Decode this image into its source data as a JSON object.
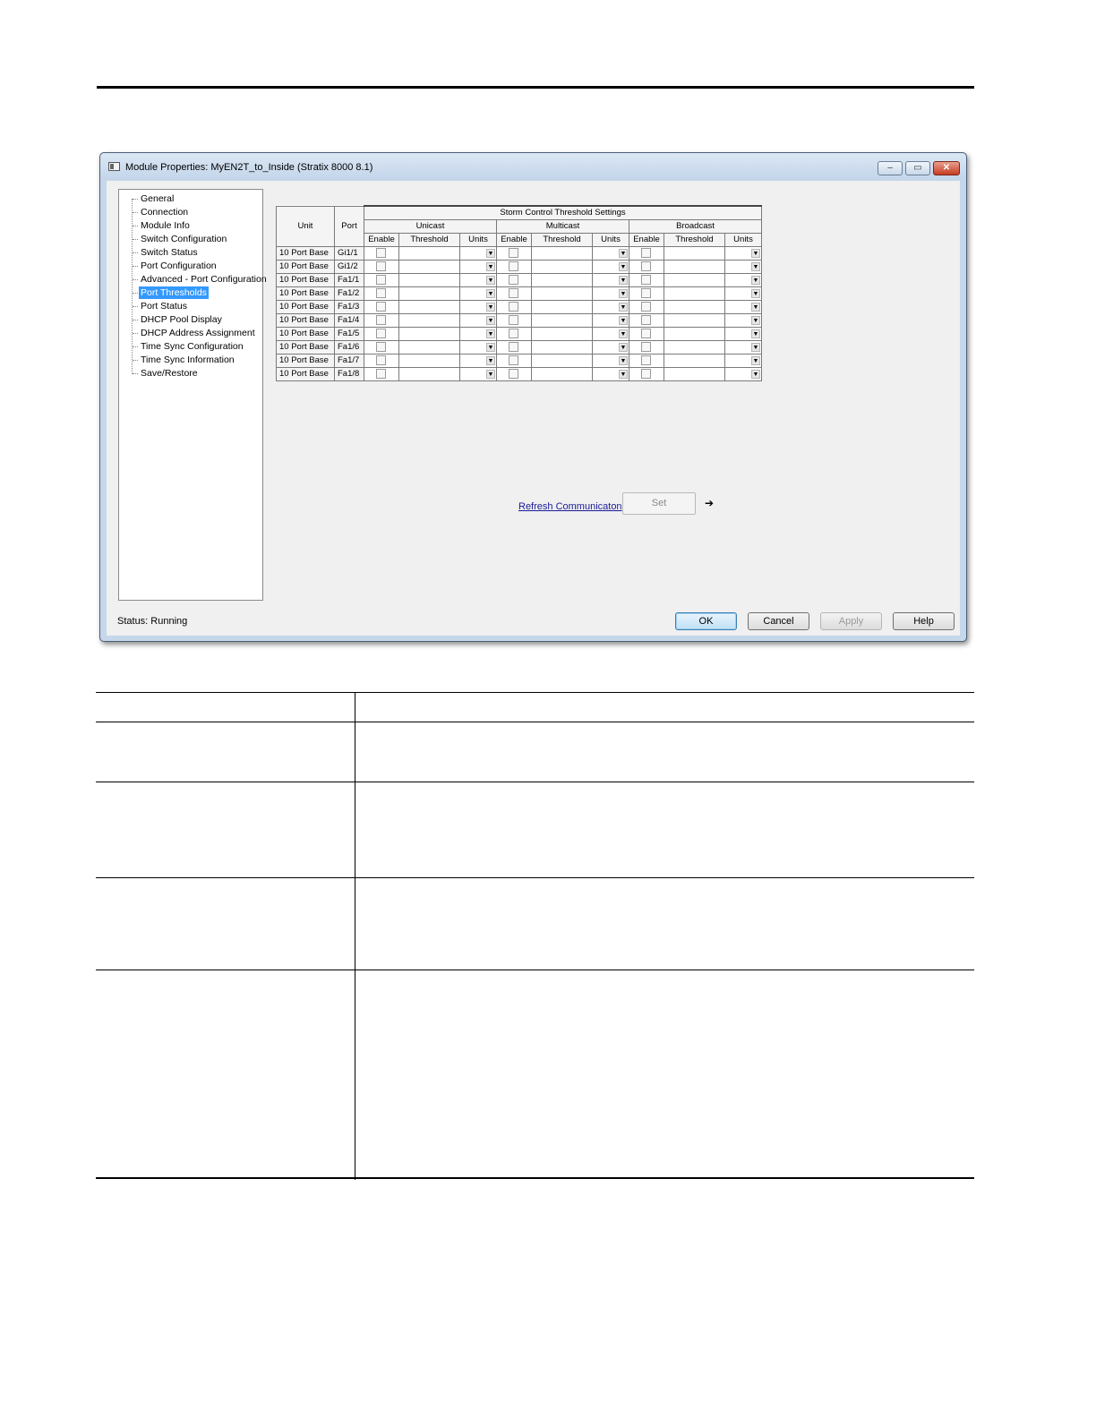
{
  "window": {
    "title": "Module Properties: MyEN2T_to_Inside (Stratix 8000 8.1)",
    "controls": {
      "minimize": "–",
      "maximize": "▭",
      "close": "✕"
    }
  },
  "tree": {
    "items": [
      "General",
      "Connection",
      "Module Info",
      "Switch Configuration",
      "Switch Status",
      "Port Configuration",
      "Advanced - Port Configuration",
      "Port Thresholds",
      "Port Status",
      "DHCP Pool Display",
      "DHCP Address Assignment",
      "Time Sync Configuration",
      "Time Sync Information",
      "Save/Restore"
    ],
    "selected": "Port Thresholds"
  },
  "grid": {
    "title": "Storm Control Threshold Settings",
    "col_unit": "Unit",
    "col_port": "Port",
    "groups": [
      "Unicast",
      "Multicast",
      "Broadcast"
    ],
    "sub_enable": "Enable",
    "sub_threshold": "Threshold",
    "sub_units": "Units",
    "rows": [
      {
        "unit": "10 Port Base",
        "port": "Gi1/1"
      },
      {
        "unit": "10 Port Base",
        "port": "Gi1/2"
      },
      {
        "unit": "10 Port Base",
        "port": "Fa1/1"
      },
      {
        "unit": "10 Port Base",
        "port": "Fa1/2"
      },
      {
        "unit": "10 Port Base",
        "port": "Fa1/3"
      },
      {
        "unit": "10 Port Base",
        "port": "Fa1/4"
      },
      {
        "unit": "10 Port Base",
        "port": "Fa1/5"
      },
      {
        "unit": "10 Port Base",
        "port": "Fa1/6"
      },
      {
        "unit": "10 Port Base",
        "port": "Fa1/7"
      },
      {
        "unit": "10 Port Base",
        "port": "Fa1/8"
      }
    ]
  },
  "actions": {
    "refresh_link": "Refresh Communicaton",
    "set_button": "Set",
    "arrow_icon": "arrow-left-icon"
  },
  "status": {
    "text": "Status:  Running"
  },
  "buttons": {
    "ok": "OK",
    "cancel": "Cancel",
    "apply": "Apply",
    "help": "Help"
  }
}
